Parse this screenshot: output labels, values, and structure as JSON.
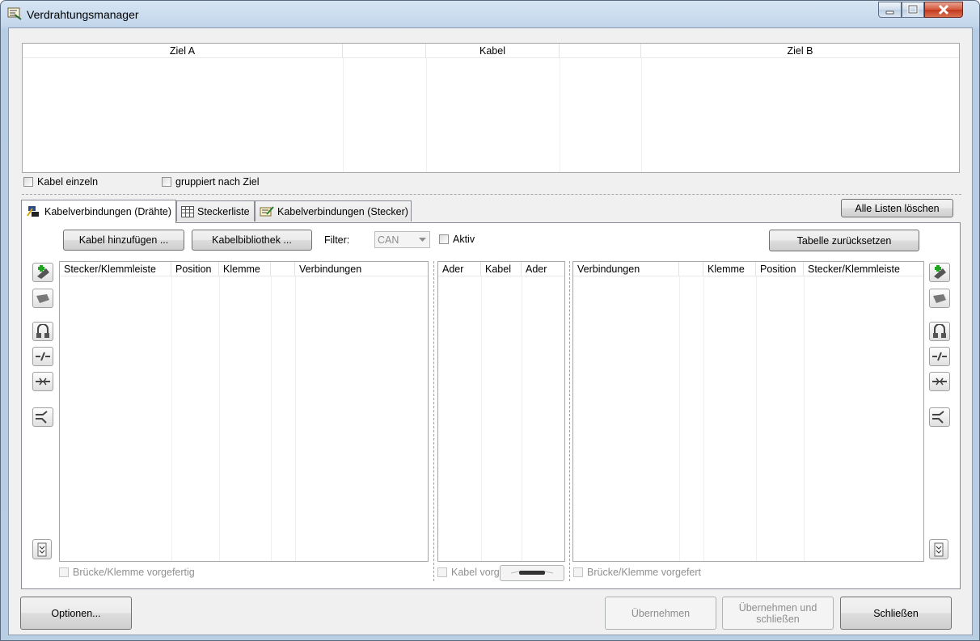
{
  "window": {
    "title": "Verdrahtungsmanager"
  },
  "top_table": {
    "headers": [
      "Ziel A",
      "Kabel",
      "Ziel B"
    ]
  },
  "options_row": {
    "kabel_einzeln": "Kabel einzeln",
    "gruppiert": "gruppiert nach Ziel"
  },
  "tabs": [
    {
      "label": "Kabelverbindungen (Drähte)",
      "icon": "wire-connection-icon"
    },
    {
      "label": "Steckerliste",
      "icon": "grid-table-icon"
    },
    {
      "label": "Kabelverbindungen (Stecker)",
      "icon": "plug-connection-icon"
    }
  ],
  "alle_listen_loeschen": "Alle Listen löschen",
  "toolbar": {
    "kabel_hinzufuegen": "Kabel hinzufügen ...",
    "kabelbibliothek": "Kabelbibliothek ...",
    "filter_label": "Filter:",
    "filter_value": "CAN",
    "aktiv": "Aktiv",
    "tabelle_zuruecksetzen": "Tabelle zurücksetzen"
  },
  "left_table": {
    "headers": [
      "Stecker/Klemmleiste",
      "Position",
      "Klemme",
      "",
      "Verbindungen"
    ]
  },
  "middle_table": {
    "headers": [
      "Ader",
      "Kabel",
      "Ader"
    ]
  },
  "right_table": {
    "headers": [
      "Verbindungen",
      "",
      "Klemme",
      "Position",
      "Stecker/Klemmleiste"
    ]
  },
  "bottom_checks": {
    "left": "Brücke/Klemme vorgefertig",
    "middle": "Kabel vorg",
    "right": "Brücke/Klemme vorgefert"
  },
  "footer": {
    "optionen": "Optionen...",
    "uebernehmen": "Übernehmen",
    "uebernehmen_schliessen_1": "Übernehmen und",
    "uebernehmen_schliessen_2": "schließen",
    "schliessen": "Schließen"
  },
  "colors": {
    "titlebar": "#c3d7ec",
    "close_button": "#c3391d",
    "panel": "#f0f0f0"
  }
}
